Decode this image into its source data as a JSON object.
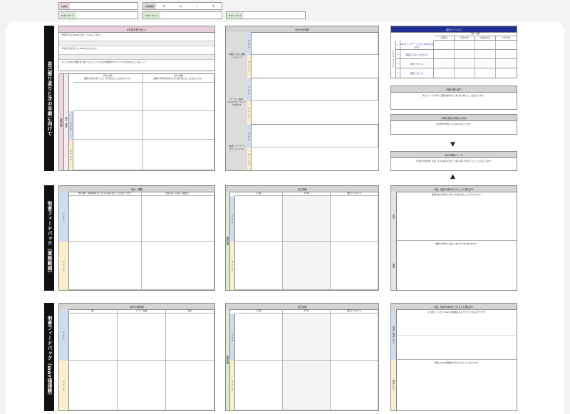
{
  "header": {
    "field1_label": "社員名",
    "field2_label": "対象期間",
    "field2_values": [
      "年",
      "月",
      "〜",
      "年"
    ],
    "supporter1_label": "サポーター①",
    "supporter2_label": "サポーター②",
    "supporter3_label": "サポーター③"
  },
  "sections": {
    "s1": "自己振り返りと次の半期に向けて",
    "s2": "他者フィードバック（業務範囲）",
    "s3": "他者フィードバック（WAY価値観）"
  },
  "s1_left": {
    "title": "半年間を振り返って",
    "q1": "半年間で自分がWOWされたことはなんですか？",
    "q2": "半年間で自分が行ったWOWはなんですか？",
    "q3": "ひとりで自分の課題を振り返ってもらうことで自分の価値観や行いについて見つめなおしてみましょう。",
    "sub_col1_title": "自分の強み",
    "sub_col1_q": "業務の強みを活かしたり、取り組んだことはなんですか？",
    "sub_col2_title": "自分の課題",
    "sub_col2_q": "業務の専門性を高めるために取り組んだことはなんですか？",
    "vlabel_main": "業務範囲",
    "vlabel_strength": "強み・課題",
    "vlabel_s": "ス キ ル",
    "vlabel_m": "マ イ ン ド"
  },
  "s1_mid": {
    "title": "WAYの体現度",
    "groups": [
      "【挑戦】 新たに挑戦していること",
      "【チーム・協調】 Wow!のパワーで チームを動かす",
      "【進化】 スーパー プロフェッショナル"
    ],
    "vlabel_s": "ス キ ル",
    "vlabel_m": "マ イ ン ド"
  },
  "matrix": {
    "title": "成長マトリクス",
    "header_group": "行動・価値",
    "col_heads": [
      "①頑張る",
      "②努力する",
      "③成果が出る",
      "④やり切る"
    ],
    "side_label": "スキル・マインド",
    "rows": [
      {
        "num": "4",
        "text": "WAYをアップデートできる WAYを生み出せる"
      },
      {
        "num": "3",
        "text": "仲間に伝えることができる"
      },
      {
        "num": "2",
        "text": "行動できている"
      },
      {
        "num": "1",
        "text": "理解できている"
      }
    ]
  },
  "s1_right": {
    "box1_title": "半期の振り返り",
    "box1_q": "次のステップに向けて課題を解決するために取り組んだことはなんですか？",
    "box2_title": "半期の成長で伸びたWay",
    "box2_q": "次の半期で伸ばしたいWayはなんですか？",
    "box3_title": "次の半期のテーマ",
    "box3_q": "【半期の行動目標】今後、自分の強みを活かした取り組みで大切にしたいことはなんですか？",
    "arrow_down": "▼",
    "arrow_up": "▲"
  },
  "s2_left": {
    "title": "強み・課題",
    "col1": "他の業務・業務範囲を広げるために取り組むことはなんですか？",
    "col2": "他者が感じる強み・課題は？",
    "vlabel_s": "ス キ ル",
    "vlabel_m": "マ イ ン ド"
  },
  "s2_mid": {
    "title": "自己評価",
    "cols": [
      "不足感",
      "不足年",
      "目標とするスキル"
    ],
    "vlabel": "業務範囲",
    "vlabel_s": "ス キ ル",
    "vlabel_m": "マ イ ン ド"
  },
  "s2_right": {
    "title": "今後、自身の強みをどのように伸ばす？",
    "q1": "業務の強みを伸ばすために何に取り組むことができますか？",
    "q2": "業務の専門性を高めるために何に取り組みますか？",
    "vl1": "強み",
    "vl2": "課題"
  },
  "s3_left": {
    "title": "WAYの体現度",
    "cols": [
      "個人",
      "チーム・組織",
      "進化"
    ],
    "vlabel_s": "ス キ ル",
    "vlabel_m": "マ イ ン ド"
  },
  "s3_mid": {
    "title": "自己評価",
    "cols": [
      "不足感",
      "不足年",
      "目標とするスキル"
    ],
    "vlabel": "業務範囲",
    "vlabel_s": "ス キ ル",
    "vlabel_m": "マ イ ン ド"
  },
  "s3_right": {
    "title": "今後、自身の強みをどのように伸ばす？",
    "q1": "より強化していきたいWAYの価値観はなんですか？それはなぜですか？",
    "q2": "仲間とのWAY価値観の共有はどのようにできますか？",
    "vl1": "強み・伸ばしたい",
    "vl2": "伸ばしたい"
  }
}
